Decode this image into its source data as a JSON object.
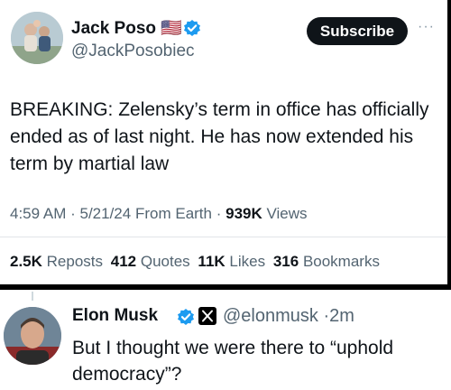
{
  "tweet": {
    "author_name": "Jack Poso",
    "author_flag": "🇺🇸",
    "author_handle": "@JackPosobiec",
    "subscribe_label": "Subscribe",
    "more_label": "···",
    "text": "BREAKING: Zelensky’s term in office has officially ended as of last night. He has now extended his term by martial law",
    "time": "4:59 AM",
    "date": "5/21/24",
    "source": "From Earth",
    "views_count": "939K",
    "views_label": "Views",
    "stats": [
      {
        "count": "2.5K",
        "label": "Reposts"
      },
      {
        "count": "412",
        "label": "Quotes"
      },
      {
        "count": "11K",
        "label": "Likes"
      },
      {
        "count": "316",
        "label": "Bookmarks"
      }
    ]
  },
  "reply": {
    "author_name": "Elon Musk",
    "author_handle": "@elonmusk",
    "age": "2m",
    "text": "But I thought we were there to “uphold democracy”?"
  },
  "colors": {
    "verified_blue": "#1d9bf0",
    "text_primary": "#0f1419",
    "text_secondary": "#536471",
    "subscribe_bg": "#0f1419"
  },
  "icons": [
    "verified-badge-icon",
    "x-logo-icon",
    "more-icon"
  ]
}
